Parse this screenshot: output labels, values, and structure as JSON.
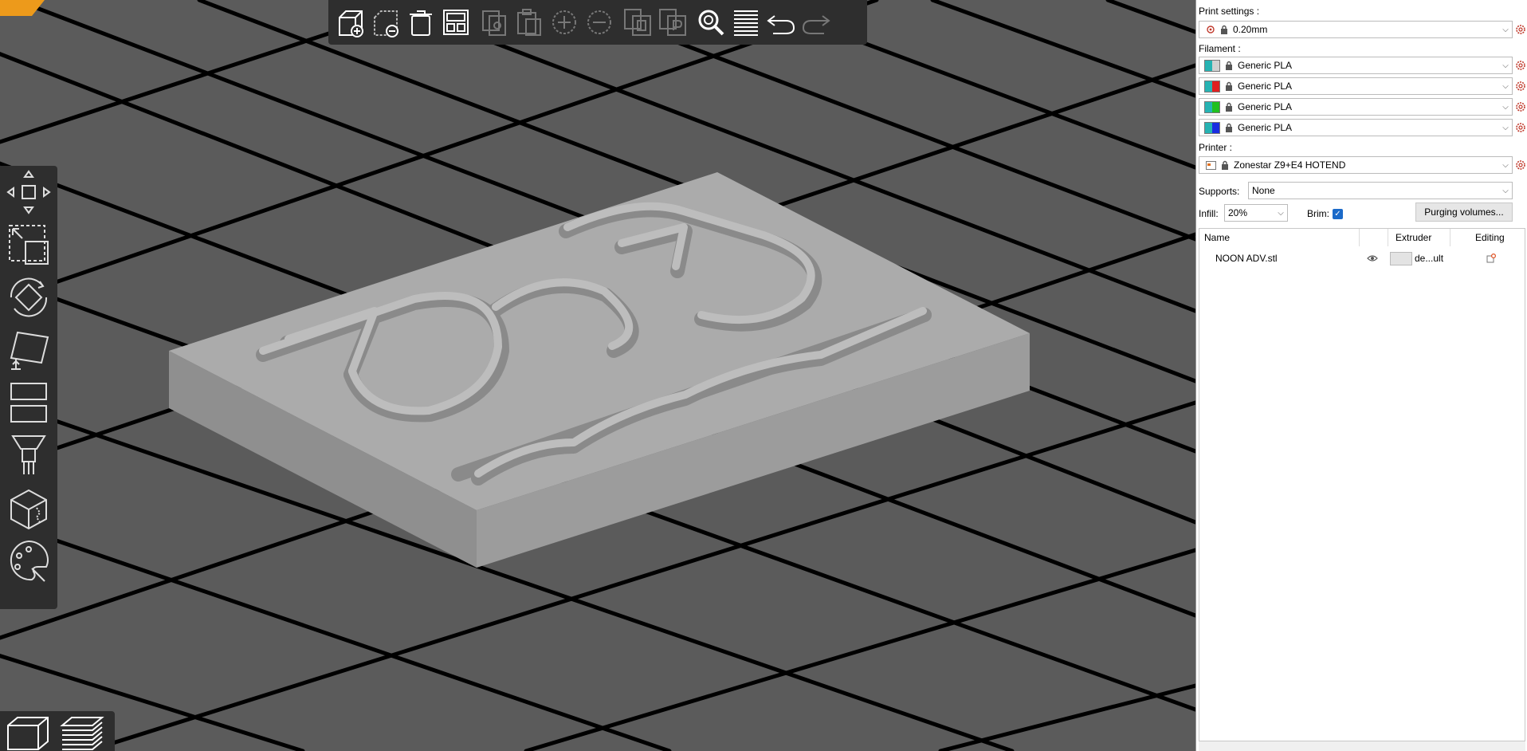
{
  "sidebar": {
    "print_settings_label": "Print settings :",
    "print_profile": "0.20mm",
    "filament_label": "Filament :",
    "filaments": [
      {
        "name": "Generic PLA",
        "swatch": [
          "#26b3b3",
          "#d0d0d0"
        ]
      },
      {
        "name": "Generic PLA",
        "swatch": [
          "#26b3b3",
          "#e02020"
        ]
      },
      {
        "name": "Generic PLA",
        "swatch": [
          "#26b3b3",
          "#20c020"
        ]
      },
      {
        "name": "Generic PLA",
        "swatch": [
          "#26b3b3",
          "#1a2de0"
        ]
      }
    ],
    "printer_label": "Printer :",
    "printer_name": "Zonestar Z9+E4 HOTEND",
    "supports_label": "Supports:",
    "supports_value": "None",
    "infill_label": "Infill:",
    "infill_value": "20%",
    "brim_label": "Brim:",
    "brim_checked": true,
    "purge_button": "Purging volumes...",
    "object_list": {
      "columns": [
        "Name",
        "Extruder",
        "Editing"
      ],
      "rows": [
        {
          "name": "NOON ADV.stl",
          "extruder": "de...ult"
        }
      ]
    }
  },
  "top_toolbar": {
    "icons": [
      "add-icon",
      "delete-icon",
      "delete-all-icon",
      "arrange-icon",
      "copy-icon",
      "paste-icon",
      "add-instance-icon",
      "remove-instance-icon",
      "split-objects-icon",
      "split-parts-icon",
      "search-icon",
      "layers-icon",
      "undo-icon",
      "redo-icon"
    ]
  },
  "left_toolbar": {
    "icons": [
      "move-icon",
      "scale-icon",
      "rotate-icon",
      "place-on-face-icon",
      "cut-icon",
      "supports-paint-icon",
      "seam-paint-icon",
      "mmu-paint-icon"
    ]
  },
  "colors": {
    "viewport_bg": "#5b5b5b",
    "toolbar_bg": "#2e2e2e",
    "model": "#a9a9a9",
    "accent_orange": "#ed9a1b",
    "checkbox_blue": "#1b6ac9"
  }
}
